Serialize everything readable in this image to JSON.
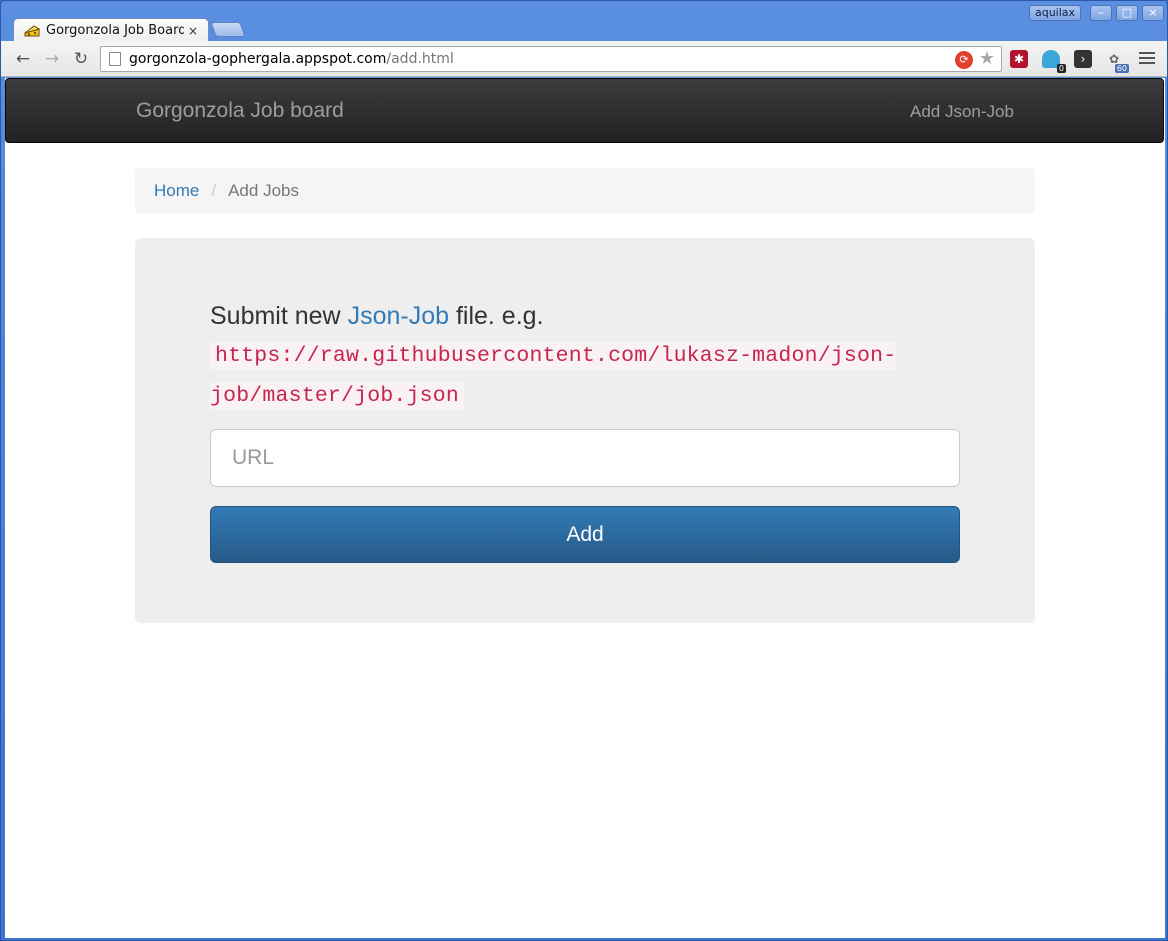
{
  "browser": {
    "tab_title": "Gorgonzola Job Board",
    "tab_close": "×",
    "profile_name": "aquilax",
    "url_host": "gorgonzola-gophergala.appspot.com",
    "url_path": "/add.html",
    "ext_badge_1": "0",
    "ext_badge_2": "60"
  },
  "navbar": {
    "brand": "Gorgonzola Job board",
    "link": "Add Json-Job"
  },
  "breadcrumb": {
    "home": "Home",
    "separator": "/",
    "current": "Add Jobs"
  },
  "form": {
    "lead_prefix": "Submit new ",
    "lead_link": "Json-Job",
    "lead_suffix": " file. e.g.",
    "example_url": "https://raw.githubusercontent.com/lukasz-madon/json-job/master/job.json",
    "url_placeholder": "URL",
    "submit_label": "Add"
  },
  "colors": {
    "primary": "#337ab7",
    "navbar": "#222222",
    "code": "#c7254e"
  }
}
